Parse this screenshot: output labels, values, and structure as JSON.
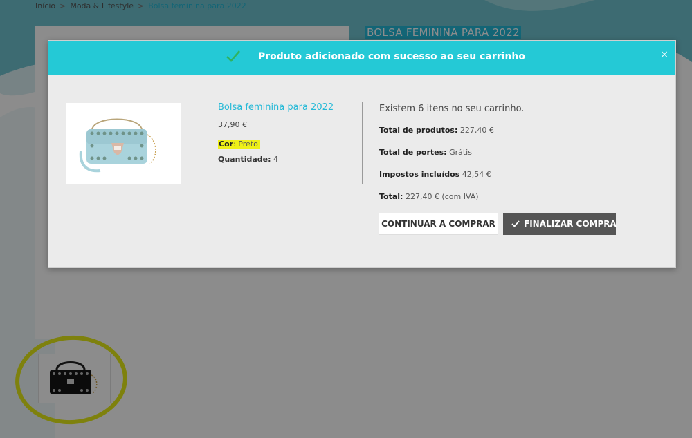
{
  "breadcrumb": {
    "items": [
      "Início",
      "Moda & Lifestyle",
      "Bolsa feminina para 2022"
    ]
  },
  "product_page": {
    "title": "BOLSA FEMININA PARA 2022"
  },
  "modal": {
    "header_text": "Produto adicionado com sucesso ao seu carrinho",
    "close_glyph": "×",
    "product": {
      "name": "Bolsa feminina para 2022",
      "price": "37,90 €",
      "attr_label": "Cor",
      "attr_value": ": Preto",
      "qty_label": "Quantidade:",
      "qty_value": " 4"
    },
    "cart": {
      "count_text": "Existem 6 itens no seu carrinho.",
      "products_label": "Total de produtos:",
      "products_value": " 227,40 €",
      "shipping_label": "Total de portes:",
      "shipping_value": " Grátis",
      "taxes_label": "Impostos incluídos",
      "taxes_value": " 42,54 €",
      "total_label": "Total:",
      "total_value": " 227,40 € (com IVA)"
    },
    "buttons": {
      "continue": "CONTINUAR A COMPRAR",
      "checkout": "FINALIZAR COMPRA"
    }
  },
  "colors": {
    "accent": "#24c9d6",
    "link": "#24b9d7",
    "highlight": "#eef018",
    "checkout_bg": "#555555"
  },
  "icons": {
    "success": "check-icon",
    "close": "close-icon",
    "checkout": "check-icon"
  }
}
